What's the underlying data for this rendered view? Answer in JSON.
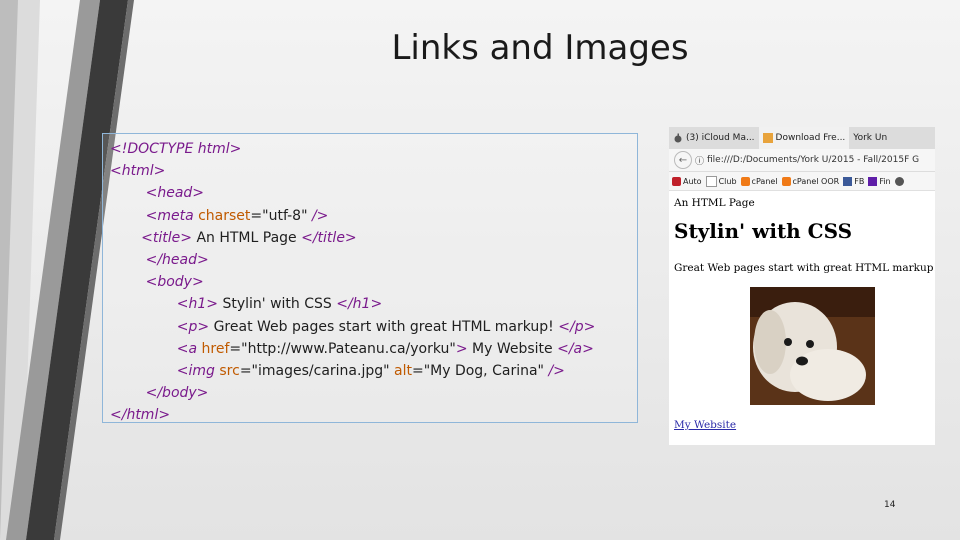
{
  "slide": {
    "title": "Links and Images",
    "page_number": "14"
  },
  "code": {
    "doctype": "<!DOCTYPE html>",
    "html_open": "<html>",
    "head_open": "<head>",
    "meta_tag_open": "<meta ",
    "meta_attr": "charset",
    "meta_eq": "=\"utf-8\" ",
    "meta_close": "/>",
    "title_open": "<title>",
    "title_text": " An HTML Page ",
    "title_close": "</title>",
    "head_close": "</head>",
    "body_open": "<body>",
    "h1_open": "<h1>",
    "h1_text": " Stylin' with CSS ",
    "h1_close": "</h1>",
    "p_open": "<p>",
    "p_text": " Great Web pages start with great HTML markup! ",
    "p_close": "</p>",
    "a_open": "<a ",
    "a_attr": "href",
    "a_val": "=\"http://www.Pateanu.ca/yorku\"",
    "a_gt": ">",
    "a_text": " My Website ",
    "a_close": "</a>",
    "img_open": "<img ",
    "img_src_attr": "src",
    "img_src_val": "=\"images/carina.jpg\" ",
    "img_alt_attr": "alt",
    "img_alt_val": "=\"My Dog, Carina\" ",
    "img_close": "/>",
    "body_close": "</body>",
    "html_close": "</html>"
  },
  "browser": {
    "tabs": [
      "(3) iCloud Ma...",
      "Download Fre...",
      "York Un"
    ],
    "address": "file:///D:/Documents/York U/2015 - Fall/2015F G",
    "bookmarks": [
      "Auto",
      "Club",
      "cPanel",
      "cPanel OOR",
      "FB",
      "Fin"
    ],
    "page": {
      "doc_title": "An HTML Page",
      "heading": "Stylin' with CSS",
      "paragraph": "Great Web pages start with great HTML markup!",
      "link": "My Website"
    }
  },
  "colors": {
    "stripe_dark": "#3a3a3a",
    "stripe_gray": "#8a8a8a",
    "tag": "#7a1a8c",
    "attr": "#c05a00",
    "box_border": "#8fb6d9",
    "link": "#2a2aa8"
  }
}
